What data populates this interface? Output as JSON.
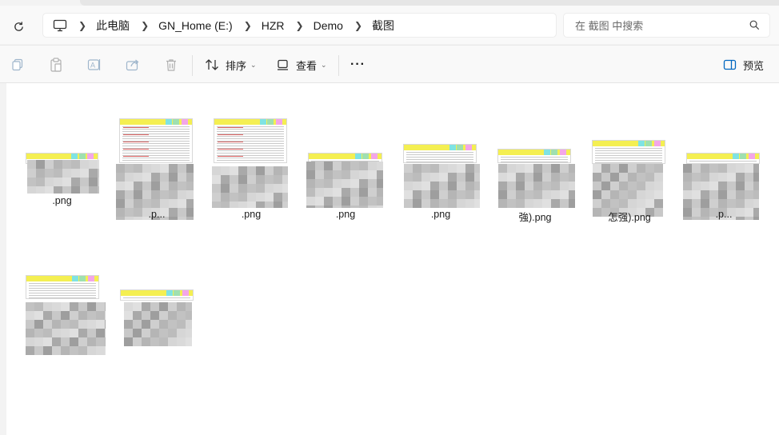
{
  "breadcrumb": {
    "items": [
      "此电脑",
      "GN_Home (E:)",
      "HZR",
      "Demo",
      "截图"
    ]
  },
  "search": {
    "placeholder": "在 截图 中搜索"
  },
  "toolbar": {
    "sort_label": "排序",
    "view_label": "查看",
    "more_label": "···",
    "preview_label": "预览",
    "icons": [
      "copy-icon",
      "paste-icon",
      "rename-icon",
      "share-icon",
      "delete-icon"
    ]
  },
  "files": [
    {
      "label": ".png"
    },
    {
      "label": ".p..."
    },
    {
      "label": ".png"
    },
    {
      "label": ".png"
    },
    {
      "label": ".png"
    },
    {
      "label": "強).png"
    },
    {
      "label": "怎强).png"
    },
    {
      "label": ".p..."
    },
    {
      "label": ""
    },
    {
      "label": ""
    }
  ],
  "colors": {
    "accent": "#0067c0",
    "thumb_header": "#f4ef52"
  }
}
